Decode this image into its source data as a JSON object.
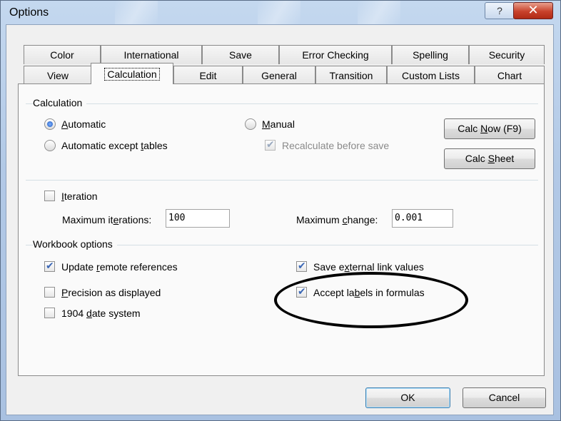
{
  "window": {
    "title": "Options",
    "help_glyph": "?",
    "close_glyph": "✕"
  },
  "tabs_row1": [
    "Color",
    "International",
    "Save",
    "Error Checking",
    "Spelling",
    "Security"
  ],
  "tabs_row2": [
    "View",
    "Calculation",
    "Edit",
    "General",
    "Transition",
    "Custom Lists",
    "Chart"
  ],
  "active_tab": "Calculation",
  "calculation": {
    "group_label": "Calculation",
    "automatic": {
      "pre": "",
      "key": "A",
      "post": "utomatic",
      "selected": true
    },
    "automatic_except_tables": {
      "pre": "Automatic except ",
      "key": "t",
      "post": "ables",
      "selected": false
    },
    "manual": {
      "pre": "",
      "key": "M",
      "post": "anual",
      "selected": false
    },
    "recalculate_before_save": {
      "label": "Recalculate before save",
      "checked": true,
      "disabled": true
    },
    "calc_now": {
      "pre": "Calc ",
      "key": "N",
      "post": "ow (F9)"
    },
    "calc_sheet": {
      "pre": "Calc ",
      "key": "S",
      "post": "heet"
    }
  },
  "iteration": {
    "checkbox": {
      "pre": "",
      "key": "I",
      "post": "teration",
      "checked": false
    },
    "max_iterations": {
      "pre": "Maximum it",
      "key": "e",
      "post": "rations:",
      "value": "100"
    },
    "max_change": {
      "pre": "Maximum ",
      "key": "c",
      "post": "hange:",
      "value": "0.001"
    }
  },
  "workbook": {
    "group_label": "Workbook options",
    "update_remote": {
      "pre": "Update ",
      "key": "r",
      "post": "emote references",
      "checked": true
    },
    "precision": {
      "pre": "",
      "key": "P",
      "post": "recision as displayed",
      "checked": false
    },
    "date_1904": {
      "pre": "1904 ",
      "key": "d",
      "post": "ate system",
      "checked": false
    },
    "save_external": {
      "pre": "Save e",
      "key": "x",
      "post": "ternal link values",
      "checked": true
    },
    "accept_labels": {
      "pre": "Accept la",
      "key": "b",
      "post": "els in formulas",
      "checked": true
    }
  },
  "buttons": {
    "ok": "OK",
    "cancel": "Cancel"
  },
  "colors": {
    "title_gradient_top": "#c4d8ef",
    "close_red": "#c8412b",
    "accent_blue": "#3b67b5",
    "annotation": "#000000"
  }
}
